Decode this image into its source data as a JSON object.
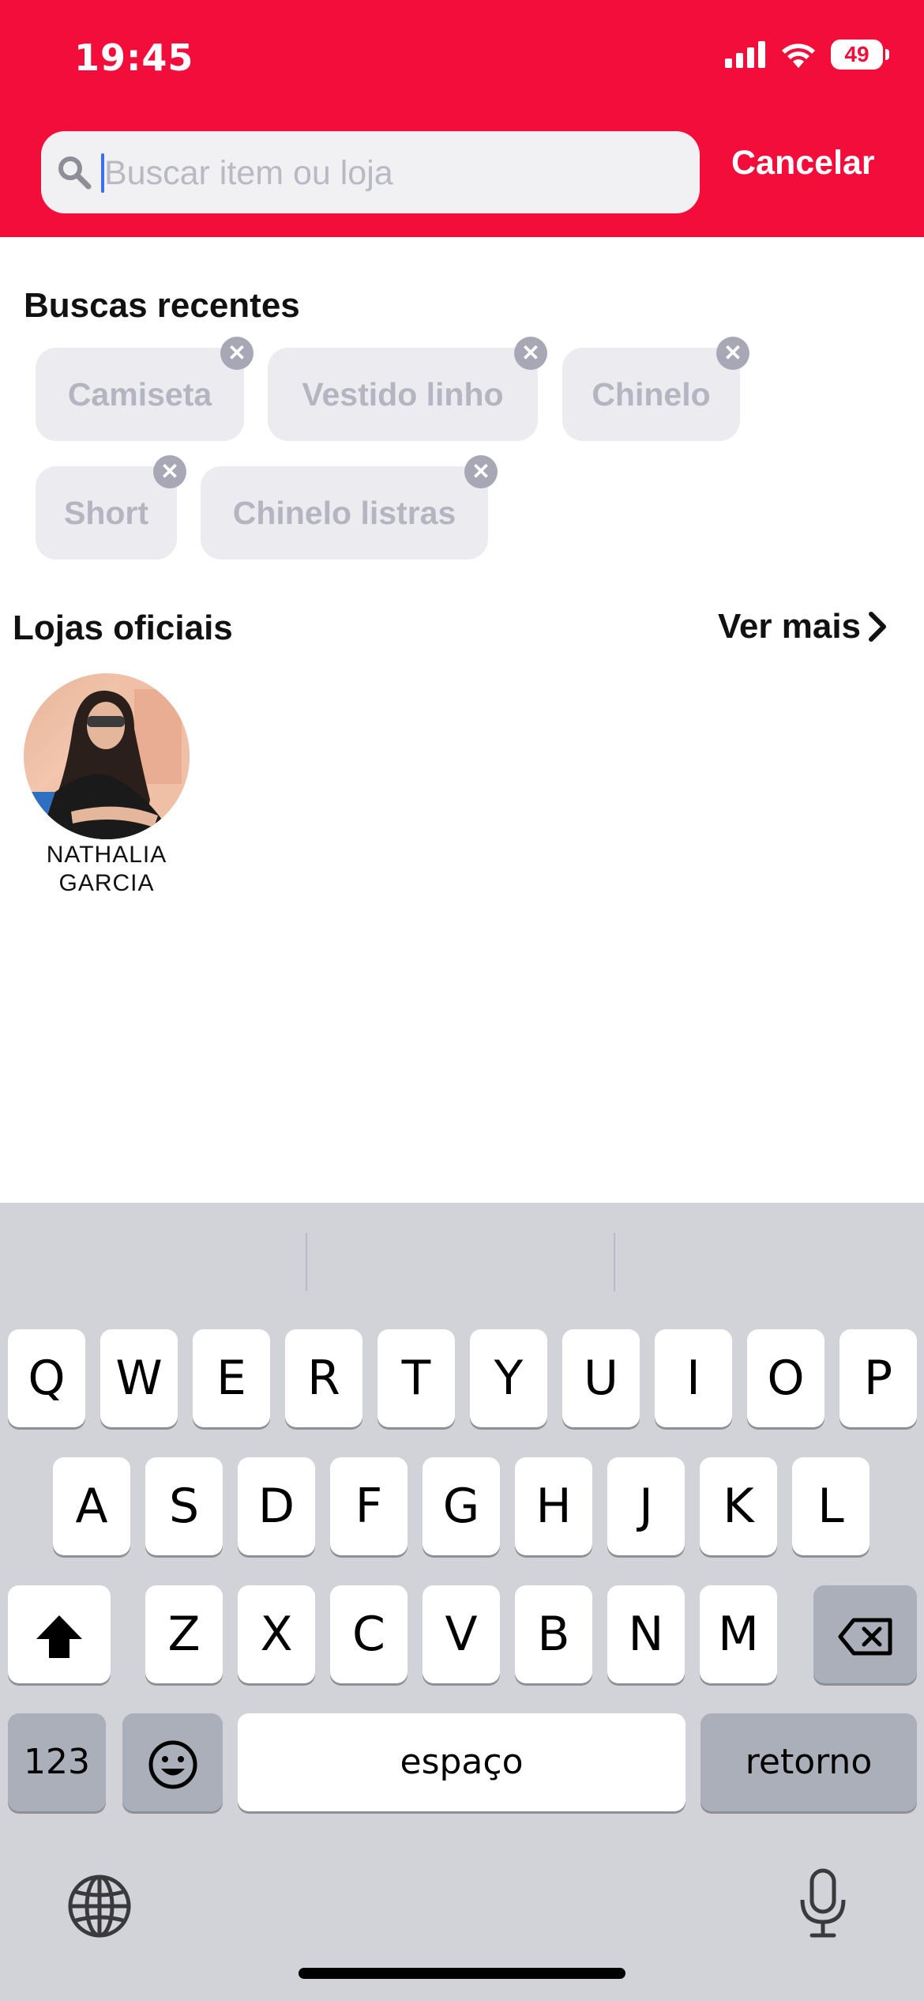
{
  "status_bar": {
    "time": "19:45",
    "battery": "49"
  },
  "search": {
    "placeholder": "Buscar item ou loja",
    "value": "",
    "cancel_label": "Cancelar"
  },
  "recent": {
    "title": "Buscas recentes",
    "chips": [
      "Camiseta",
      "Vestido linho",
      "Chinelo",
      "Short",
      "Chinelo listras"
    ]
  },
  "official_stores": {
    "title": "Lojas oficiais",
    "see_more": "Ver mais",
    "stores": [
      {
        "name_line1": "NATHALIA",
        "name_line2": "GARCIA"
      }
    ]
  },
  "keyboard": {
    "row1": [
      "Q",
      "W",
      "E",
      "R",
      "T",
      "Y",
      "U",
      "I",
      "O",
      "P"
    ],
    "row2": [
      "A",
      "S",
      "D",
      "F",
      "G",
      "H",
      "J",
      "K",
      "L"
    ],
    "row3": [
      "Z",
      "X",
      "C",
      "V",
      "B",
      "N",
      "M"
    ],
    "numbers_label": "123",
    "space_label": "espaço",
    "return_label": "retorno"
  },
  "colors": {
    "brand_red": "#f20d3a",
    "keyboard_bg": "#d1d3d9"
  }
}
